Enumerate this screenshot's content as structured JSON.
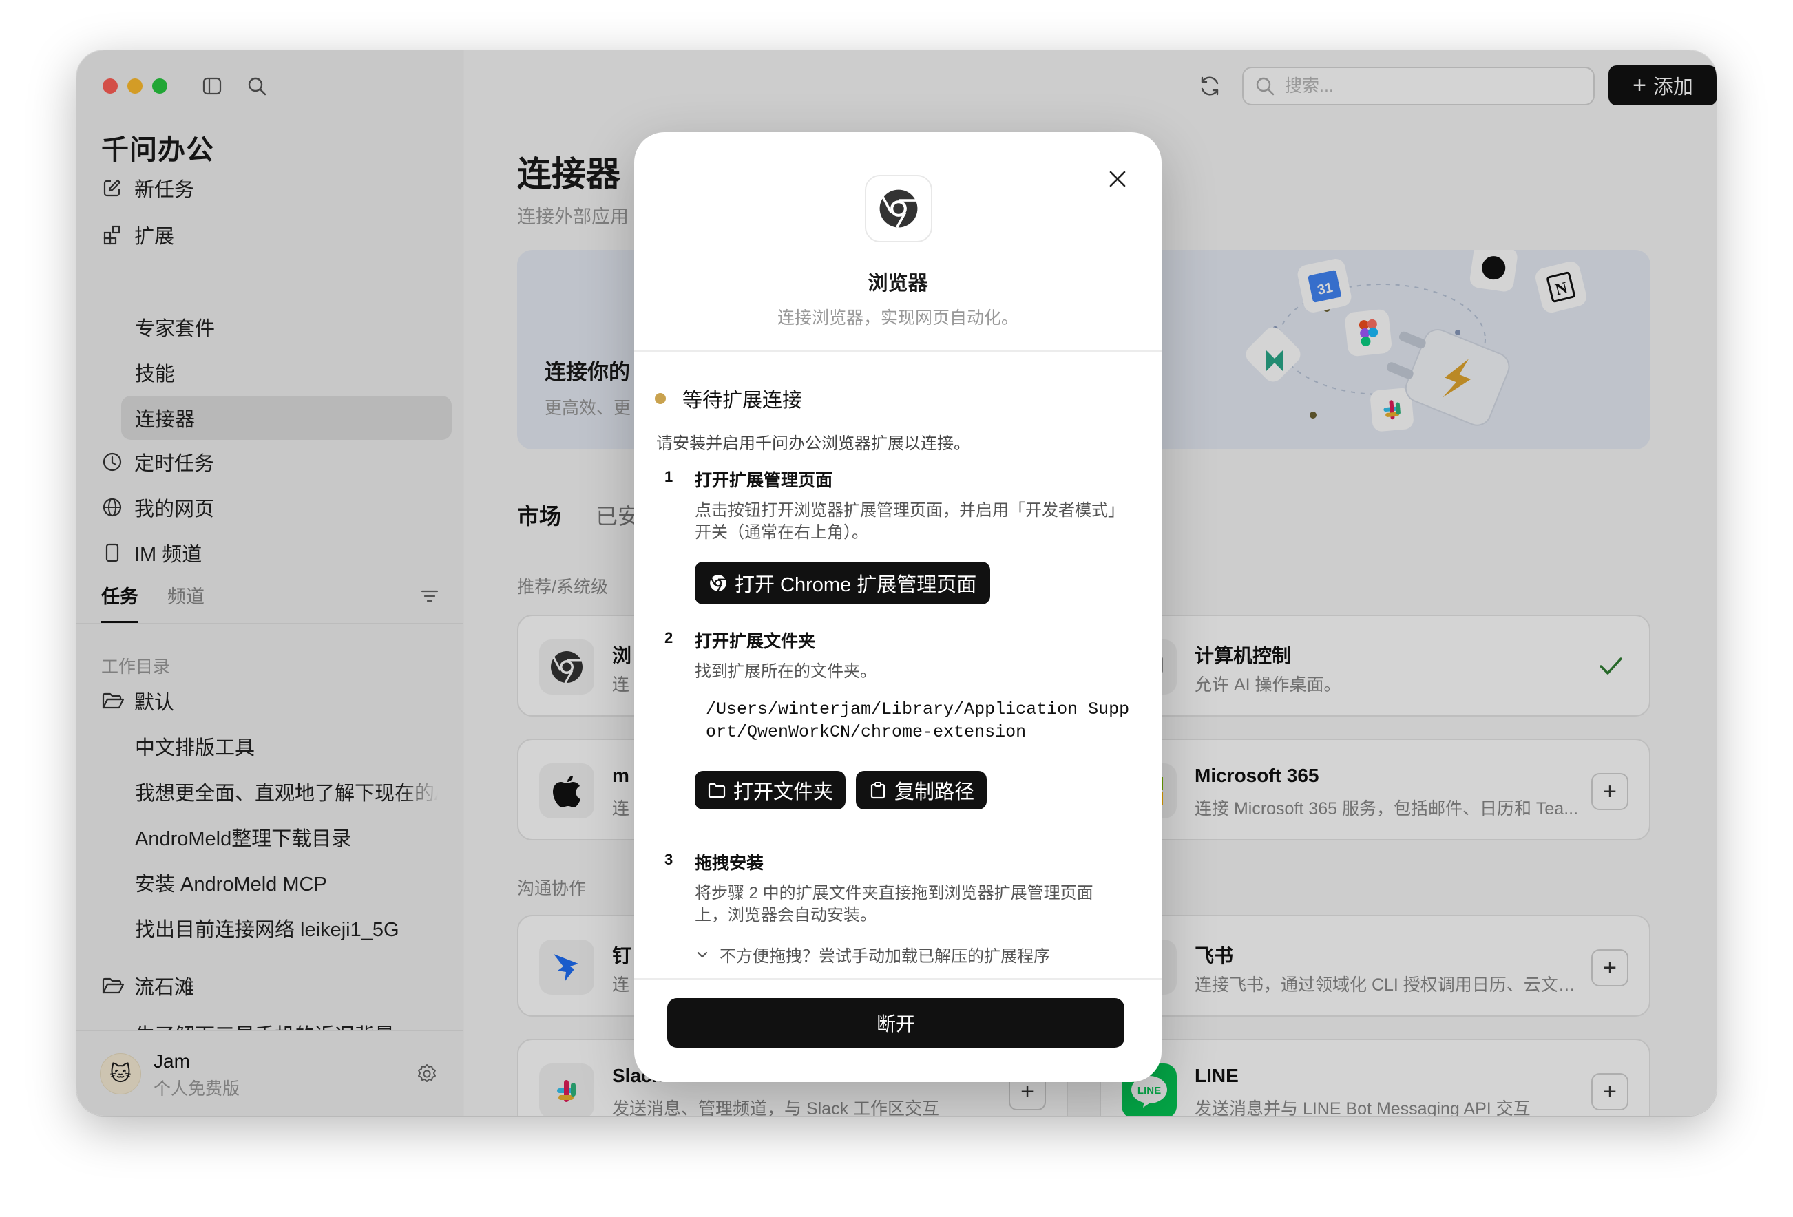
{
  "app": {
    "title": "千问办公",
    "colors": {
      "accent": "#111111",
      "status_waiting": "#c9a24e",
      "connected_check": "#2e7d32",
      "banner_bg": "#e6ebf4"
    }
  },
  "sidebar": {
    "nav": [
      {
        "label": "新任务",
        "icon": "edit-icon"
      },
      {
        "label": "扩展",
        "icon": "extensions-icon"
      },
      {
        "label": "定时任务",
        "icon": "clock-icon"
      },
      {
        "label": "我的网页",
        "icon": "globe-icon"
      },
      {
        "label": "IM 频道",
        "icon": "phone-icon"
      }
    ],
    "sub_items": [
      "专家套件",
      "技能",
      "连接器"
    ],
    "active_sub": "连接器",
    "tabs": [
      "任务",
      "频道"
    ],
    "work_dir_label": "工作目录",
    "folders": [
      {
        "name": "默认",
        "tasks": [
          "中文排版工具",
          "我想更全面、直观地了解下现在的AI",
          "AndroMeld整理下载目录",
          "安装 AndroMeld MCP",
          "找出目前连接网络 leikeji1_5G"
        ]
      },
      {
        "name": "流石滩",
        "tasks": [
          "生了解下三星手机的近况背景"
        ]
      }
    ],
    "user": {
      "name": "Jam",
      "plan": "个人免费版",
      "avatar": "🐱"
    }
  },
  "header": {
    "search_placeholder": "搜索...",
    "add_label": "添加"
  },
  "main": {
    "title": "连接器",
    "subtitle": "连接外部应用",
    "banner": {
      "title": "连接你的",
      "subtitle": "更高效、更"
    },
    "tabs": [
      "市场",
      "已安"
    ],
    "sections": [
      {
        "label": "推荐/系统级"
      },
      {
        "label": "沟通协作"
      }
    ],
    "cards": [
      {
        "name": "浏",
        "desc": "连",
        "icon": "chrome-icon",
        "action": "none"
      },
      {
        "name": "计算机控制",
        "desc": "允许 AI 操作桌面。",
        "icon": "computer-icon",
        "action": "check"
      },
      {
        "name": "m",
        "desc": "连",
        "icon": "apple-icon",
        "action": "none"
      },
      {
        "name": "Microsoft 365",
        "desc": "连接 Microsoft 365 服务，包括邮件、日历和 Tea...",
        "icon": "microsoft-icon",
        "action": "+"
      },
      {
        "name": "钉",
        "desc": "连",
        "icon": "dingtalk-icon",
        "action": "none"
      },
      {
        "name": "飞书",
        "desc": "连接飞书，通过领域化 CLI 授权调用日历、云文档...",
        "icon": "feishu-icon",
        "action": "+"
      },
      {
        "name": "Slack",
        "desc": "发送消息、管理频道，与 Slack 工作区交互",
        "icon": "slack-icon",
        "action": "+"
      },
      {
        "name": "LINE",
        "desc": "发送消息并与 LINE Bot Messaging API 交互",
        "icon": "line-icon",
        "action": "+"
      }
    ]
  },
  "modal": {
    "title": "浏览器",
    "subtitle": "连接浏览器，实现网页自动化。",
    "status": "等待扩展连接",
    "instruction": "请安装并启用千问办公浏览器扩展以连接。",
    "steps": [
      {
        "num": "1",
        "title": "打开扩展管理页面",
        "desc": "点击按钮打开浏览器扩展管理页面，并启用「开发者模式」开关（通常在右上角）。",
        "button": "打开 Chrome 扩展管理页面"
      },
      {
        "num": "2",
        "title": "打开扩展文件夹",
        "desc": "找到扩展所在的文件夹。",
        "path": "/Users/winterjam/Library/Application Support/QwenWorkCN/chrome-extension",
        "buttons": [
          "打开文件夹",
          "复制路径"
        ]
      },
      {
        "num": "3",
        "title": "拖拽安装",
        "desc": "将步骤 2 中的扩展文件夹直接拖到浏览器扩展管理页面上，浏览器会自动安装。"
      }
    ],
    "expand_hint": "不方便拖拽？尝试手动加载已解压的扩展程序",
    "disconnect_label": "断开"
  }
}
